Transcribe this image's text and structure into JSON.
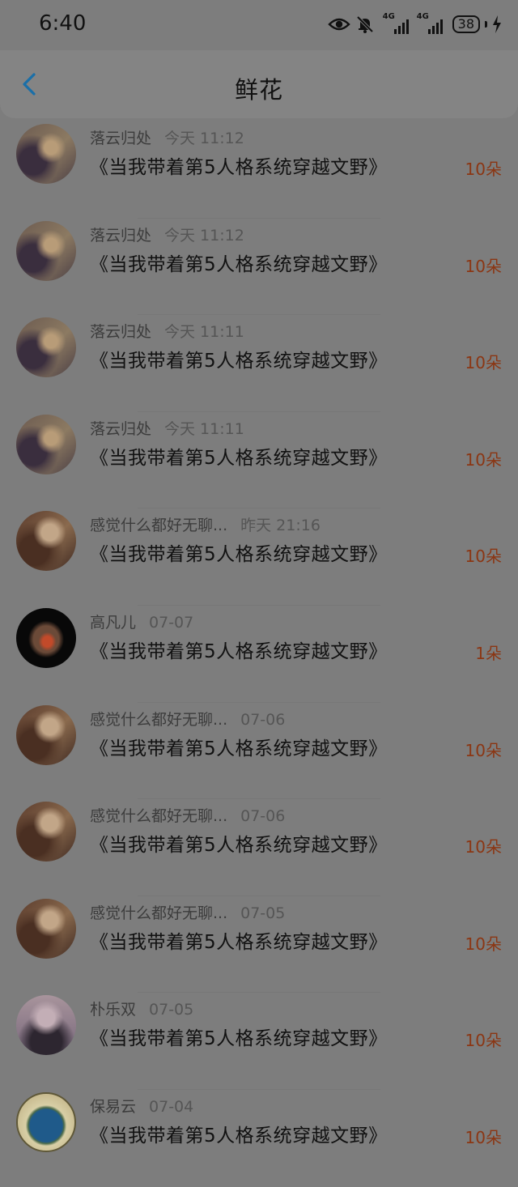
{
  "status_bar": {
    "time": "6:40",
    "network_1": "4G",
    "network_2": "4G",
    "battery": "38",
    "icons": [
      "eye-icon",
      "bell-off-icon",
      "signal-4g-icon",
      "signal-4g-icon",
      "battery-icon",
      "charging-icon"
    ]
  },
  "header": {
    "title": "鲜花",
    "back_icon": "chevron-left-icon"
  },
  "items": [
    {
      "user": "落云归处",
      "time": "今天 11:12",
      "book": "《当我带着第5人格系统穿越文野》",
      "count": "10朵"
    },
    {
      "user": "落云归处",
      "time": "今天 11:12",
      "book": "《当我带着第5人格系统穿越文野》",
      "count": "10朵"
    },
    {
      "user": "落云归处",
      "time": "今天 11:11",
      "book": "《当我带着第5人格系统穿越文野》",
      "count": "10朵"
    },
    {
      "user": "落云归处",
      "time": "今天 11:11",
      "book": "《当我带着第5人格系统穿越文野》",
      "count": "10朵"
    },
    {
      "user": "感觉什么都好无聊...",
      "time": "昨天 21:16",
      "book": "《当我带着第5人格系统穿越文野》",
      "count": "10朵"
    },
    {
      "user": "高凡儿",
      "time": "07-07",
      "book": "《当我带着第5人格系统穿越文野》",
      "count": "1朵"
    },
    {
      "user": "感觉什么都好无聊...",
      "time": "07-06",
      "book": "《当我带着第5人格系统穿越文野》",
      "count": "10朵"
    },
    {
      "user": "感觉什么都好无聊...",
      "time": "07-06",
      "book": "《当我带着第5人格系统穿越文野》",
      "count": "10朵"
    },
    {
      "user": "感觉什么都好无聊...",
      "time": "07-05",
      "book": "《当我带着第5人格系统穿越文野》",
      "count": "10朵"
    },
    {
      "user": "朴乐双",
      "time": "07-05",
      "book": "《当我带着第5人格系统穿越文野》",
      "count": "10朵"
    },
    {
      "user": "保易云",
      "time": "07-04",
      "book": "《当我带着第5人格系统穿越文野》",
      "count": "10朵"
    }
  ],
  "colors": {
    "background": "#7d7d7d",
    "accent": "#1a6fa8",
    "count": "#8b3613"
  }
}
